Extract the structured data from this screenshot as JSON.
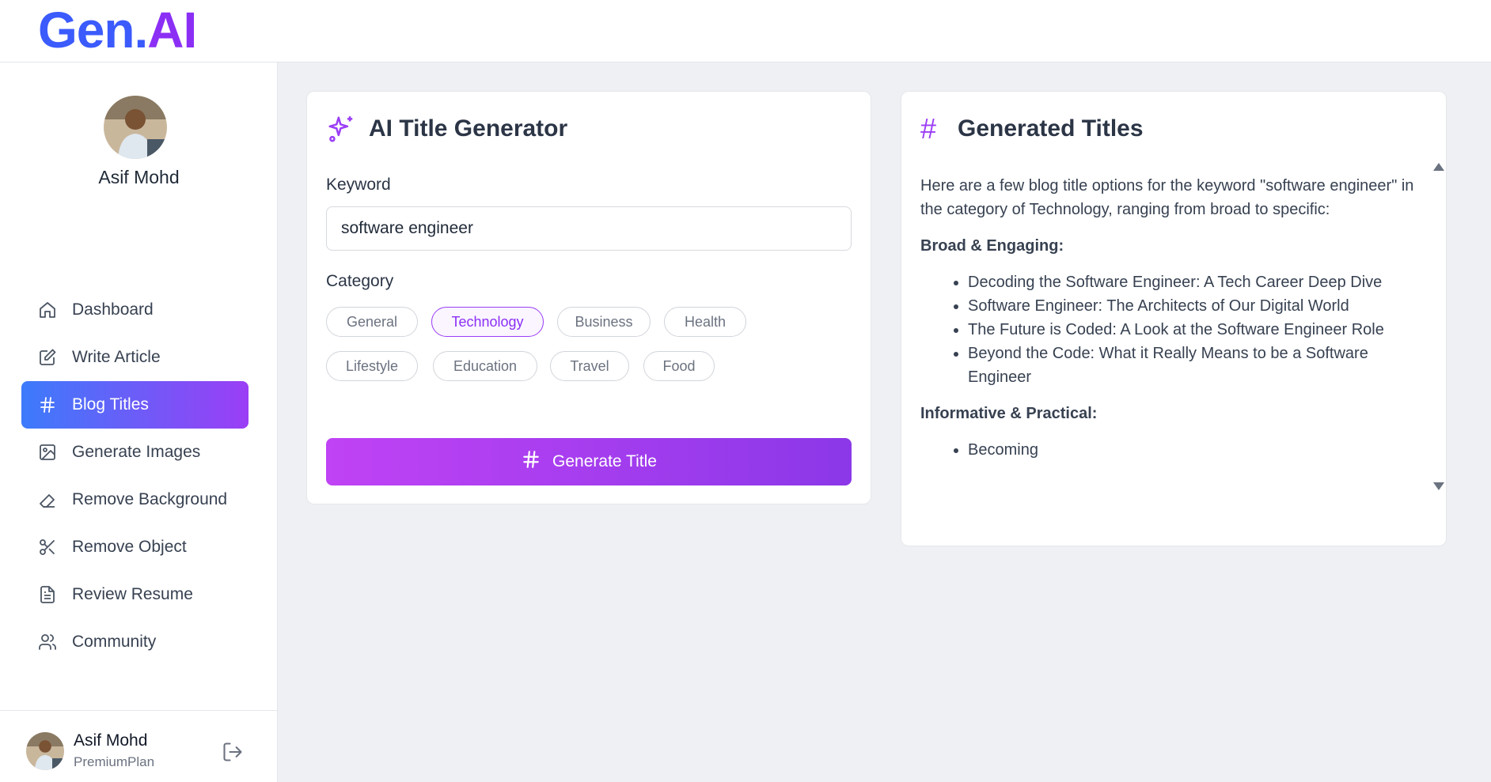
{
  "app": {
    "logo_gen": "Gen.",
    "logo_ai": "AI"
  },
  "profile": {
    "name": "Asif Mohd"
  },
  "nav": [
    {
      "label": "Dashboard",
      "icon": "home-icon"
    },
    {
      "label": "Write Article",
      "icon": "edit-icon"
    },
    {
      "label": "Blog Titles",
      "icon": "hash-icon",
      "active": true
    },
    {
      "label": "Generate Images",
      "icon": "image-icon"
    },
    {
      "label": "Remove Background",
      "icon": "eraser-icon"
    },
    {
      "label": "Remove Object",
      "icon": "scissors-icon"
    },
    {
      "label": "Review Resume",
      "icon": "file-text-icon"
    },
    {
      "label": "Community",
      "icon": "users-icon"
    }
  ],
  "footer": {
    "name": "Asif Mohd",
    "plan": "PremiumPlan"
  },
  "generator": {
    "title": "AI Title Generator",
    "keyword_label": "Keyword",
    "keyword_value": "software engineer",
    "category_label": "Category",
    "categories": [
      "General",
      "Technology",
      "Business",
      "Health",
      "Lifestyle",
      "Education",
      "Travel",
      "Food"
    ],
    "selected_category": "Technology",
    "button_label": "Generate Title"
  },
  "results": {
    "hash_symbol": "#",
    "title": "Generated Titles",
    "intro": "Here are a few blog title options for the keyword \"software engineer\" in the category of Technology, ranging from broad to specific:",
    "section1_heading": "Broad & Engaging:",
    "section1_items": [
      "Decoding the Software Engineer: A Tech Career Deep Dive",
      "Software Engineer: The Architects of Our Digital World",
      "The Future is Coded: A Look at the Software Engineer Role",
      "Beyond the Code: What it Really Means to be a Software Engineer"
    ],
    "section2_heading": "Informative & Practical:",
    "section2_items": [
      "Becoming"
    ]
  },
  "colors": {
    "accent_blue": "#3c7bfb",
    "accent_purple": "#9b3ef5",
    "button_pink": "#c043f5"
  }
}
